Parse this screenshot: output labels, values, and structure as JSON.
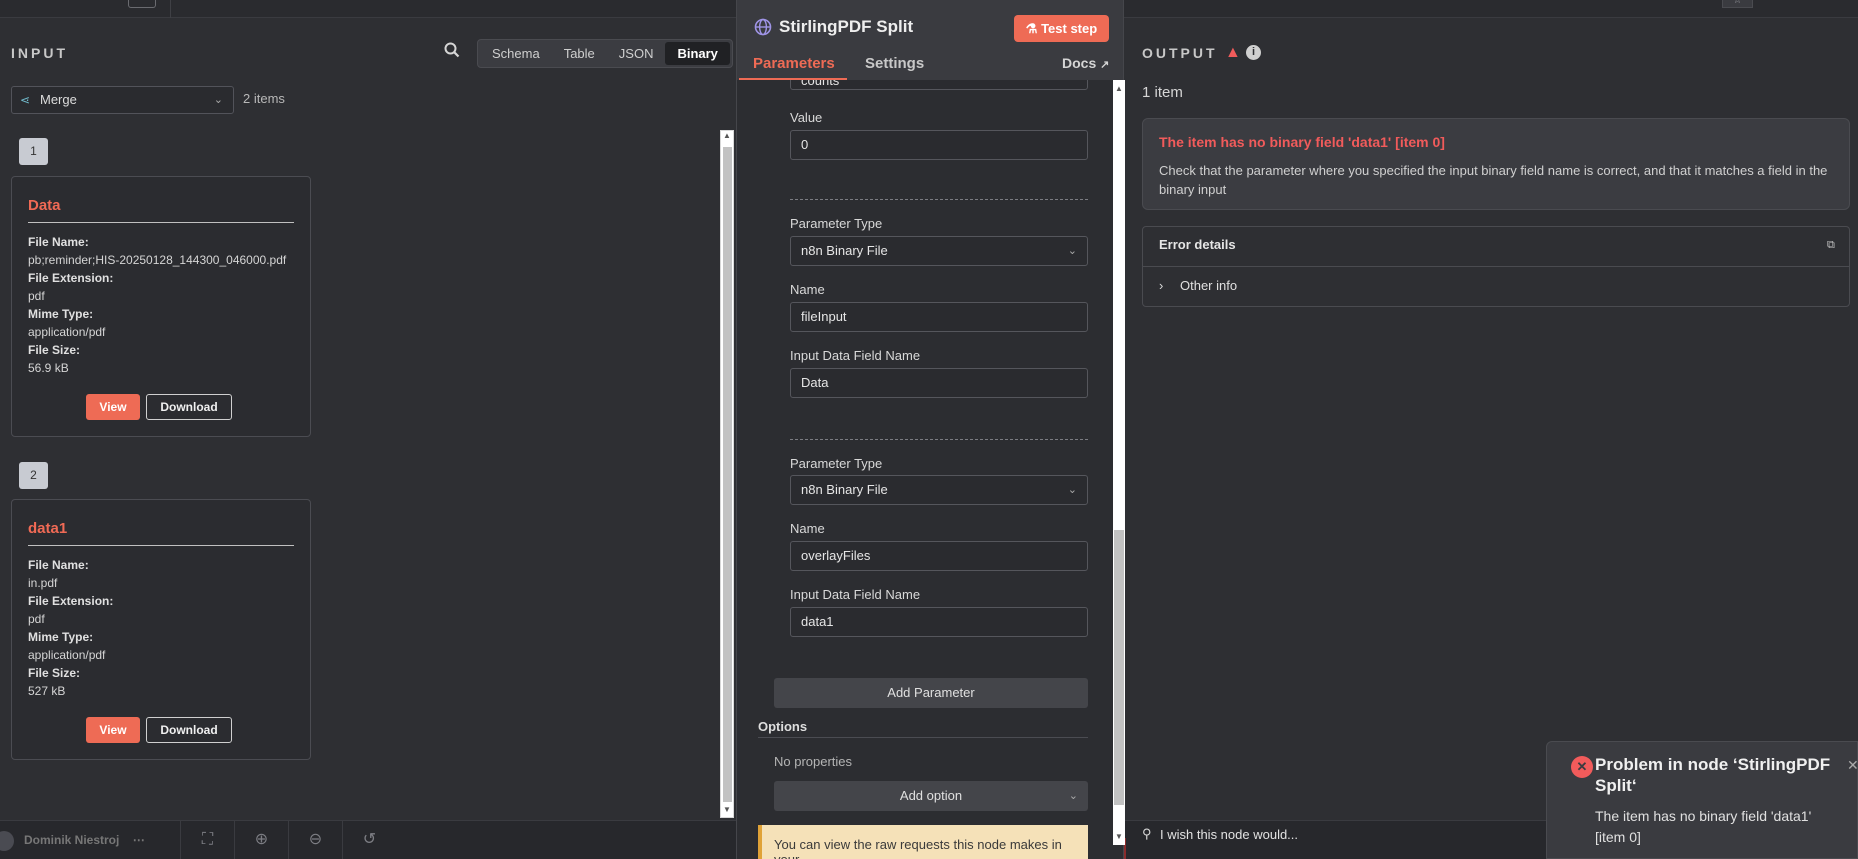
{
  "bottom": {
    "user_name": "Dominik Niestroj",
    "more": "⋯",
    "fit_icon": "fit-view-icon",
    "zoom_in_icon": "zoom-in-icon",
    "zoom_out_icon": "zoom-out-icon",
    "reset_icon": "reset-zoom-icon"
  },
  "input": {
    "title": "INPUT",
    "view_tabs": [
      "Schema",
      "Table",
      "JSON",
      "Binary"
    ],
    "active_view": "Binary",
    "node": "Merge",
    "items_count": "2 items",
    "items": [
      {
        "index": "1",
        "title": "Data",
        "fields": [
          {
            "key": "File Name:",
            "value": "pb;reminder;HIS-20250128_144300_046000.pdf"
          },
          {
            "key": "File Extension:",
            "value": "pdf"
          },
          {
            "key": "Mime Type:",
            "value": "application/pdf"
          },
          {
            "key": "File Size:",
            "value": "56.9 kB"
          }
        ],
        "view_label": "View",
        "download_label": "Download"
      },
      {
        "index": "2",
        "title": "data1",
        "fields": [
          {
            "key": "File Name:",
            "value": "in.pdf"
          },
          {
            "key": "File Extension:",
            "value": "pdf"
          },
          {
            "key": "Mime Type:",
            "value": "application/pdf"
          },
          {
            "key": "File Size:",
            "value": "527 kB"
          }
        ],
        "view_label": "View",
        "download_label": "Download"
      }
    ]
  },
  "ndv": {
    "title": "StirlingPDF Split",
    "test_step": "Test step",
    "tabs": [
      "Parameters",
      "Settings"
    ],
    "active_tab": "Parameters",
    "docs": "Docs",
    "cut_value": "counts",
    "value_label": "Value",
    "value": "0",
    "groups": [
      {
        "type_label": "Parameter Type",
        "type_value": "n8n Binary File",
        "name_label": "Name",
        "name_value": "fileInput",
        "field_label": "Input Data Field Name",
        "field_value": "Data"
      },
      {
        "type_label": "Parameter Type",
        "type_value": "n8n Binary File",
        "name_label": "Name",
        "name_value": "overlayFiles",
        "field_label": "Input Data Field Name",
        "field_value": "data1"
      }
    ],
    "add_parameter": "Add Parameter",
    "options_title": "Options",
    "no_properties": "No properties",
    "add_option": "Add option",
    "notice": "You can view the raw requests this node makes in your"
  },
  "output": {
    "title": "OUTPUT",
    "count": "1 item",
    "error_title": "The item has no binary field 'data1' [item 0]",
    "error_desc": "Check that the parameter where you specified the input binary field name is correct, and that it matches a field in the binary input",
    "details_title": "Error details",
    "other_info": "Other info",
    "feedback": "I wish this node would..."
  },
  "toast": {
    "title": "Problem in node ‘StirlingPDF Split‘",
    "message": "The item has no binary field 'data1' [item 0]"
  },
  "colors": {
    "accent": "#ee6b55",
    "error": "#f15b5b",
    "panel": "#2e2f33"
  }
}
